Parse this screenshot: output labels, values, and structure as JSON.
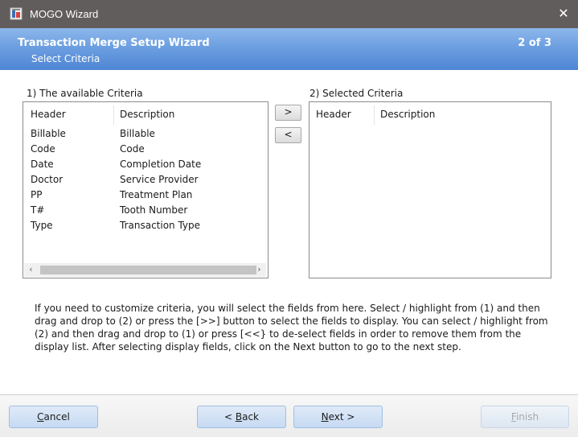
{
  "window": {
    "title": "MOGO Wizard",
    "close_glyph": "✕"
  },
  "banner": {
    "title": "Transaction Merge Setup Wizard",
    "subtitle": "Select Criteria",
    "step": "2 of 3"
  },
  "available": {
    "label": "1) The available Criteria",
    "columns": [
      "Header",
      "Description"
    ],
    "rows": [
      [
        "Billable",
        "Billable"
      ],
      [
        "Code",
        "Code"
      ],
      [
        "Date",
        "Completion Date"
      ],
      [
        "Doctor",
        "Service Provider"
      ],
      [
        "PP",
        "Treatment Plan"
      ],
      [
        "T#",
        "Tooth Number"
      ],
      [
        "Type",
        "Transaction Type"
      ]
    ],
    "scroll_left": "‹",
    "scroll_right": "›"
  },
  "selected": {
    "label": "2) Selected Criteria",
    "columns": [
      "Header",
      "Description"
    ],
    "rows": []
  },
  "move": {
    "add_label": ">",
    "remove_label": "<"
  },
  "help_text": "If you need to customize criteria,  you will select the fields from here.  Select / highlight from (1) and then drag and drop to (2) or press the [>>] button to select the fields to display.  You can select / highlight from (2) and then drag and drop to (1) or press [<<} to  de-select fields in order to remove them from the display list.  After selecting display fields, click on the Next button to go to the next step.",
  "buttons": {
    "cancel": {
      "accel": "C",
      "rest": "ancel"
    },
    "back": {
      "pre": "< ",
      "accel": "B",
      "rest": "ack"
    },
    "next": {
      "accel": "N",
      "rest": "ext >"
    },
    "finish": {
      "accel": "F",
      "rest": "inish",
      "enabled": false
    }
  },
  "colors": {
    "banner": "#6c9fe0",
    "titlebar": "#605d5c",
    "button": "#c6daf2"
  }
}
